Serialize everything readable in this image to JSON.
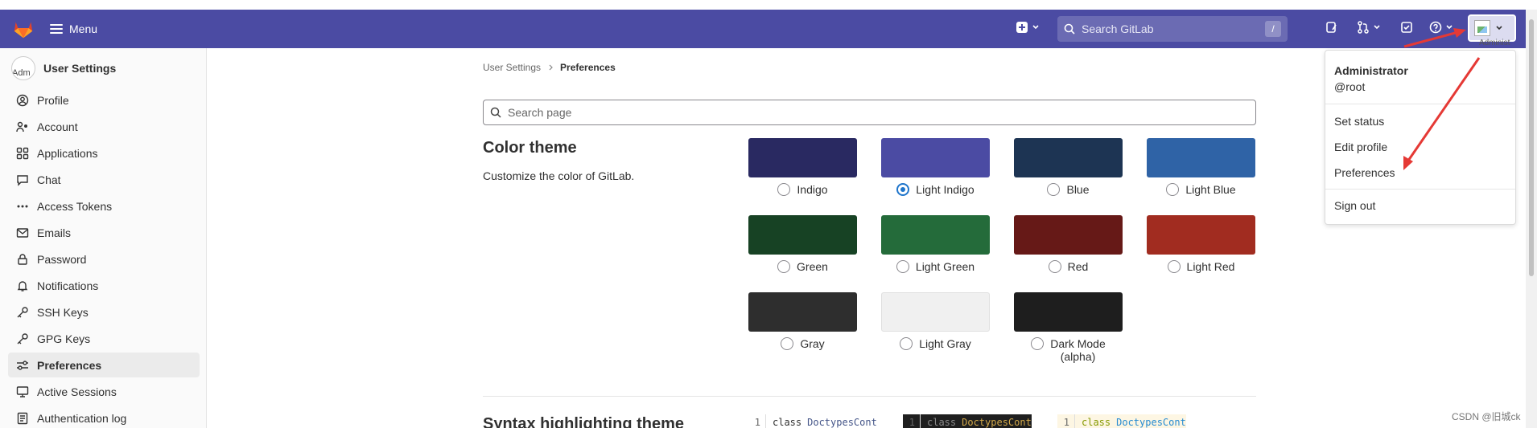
{
  "navbar": {
    "menu_label": "Menu",
    "search_placeholder": "Search GitLab",
    "search_shortcut": "/",
    "avatar_alt": "Administ"
  },
  "sidebar": {
    "title": "User Settings",
    "avatar_alt": "Adm",
    "items": [
      {
        "label": "Profile",
        "icon": "profile-icon"
      },
      {
        "label": "Account",
        "icon": "account-icon"
      },
      {
        "label": "Applications",
        "icon": "applications-icon"
      },
      {
        "label": "Chat",
        "icon": "chat-icon"
      },
      {
        "label": "Access Tokens",
        "icon": "token-icon"
      },
      {
        "label": "Emails",
        "icon": "mail-icon"
      },
      {
        "label": "Password",
        "icon": "lock-icon"
      },
      {
        "label": "Notifications",
        "icon": "bell-icon"
      },
      {
        "label": "SSH Keys",
        "icon": "key-icon"
      },
      {
        "label": "GPG Keys",
        "icon": "key-icon"
      },
      {
        "label": "Preferences",
        "icon": "preferences-icon",
        "active": true
      },
      {
        "label": "Active Sessions",
        "icon": "monitor-icon"
      },
      {
        "label": "Authentication log",
        "icon": "log-icon"
      }
    ]
  },
  "breadcrumb": {
    "parent": "User Settings",
    "current": "Preferences"
  },
  "page_search": {
    "placeholder": "Search page"
  },
  "color_theme": {
    "title": "Color theme",
    "description": "Customize the color of GitLab.",
    "options": [
      {
        "label": "Indigo",
        "color": "#292961",
        "checked": false
      },
      {
        "label": "Light Indigo",
        "color": "#4b4ba3",
        "checked": true
      },
      {
        "label": "Blue",
        "color": "#1d3453",
        "checked": false
      },
      {
        "label": "Light Blue",
        "color": "#2f63a6",
        "checked": false
      },
      {
        "label": "Green",
        "color": "#174224",
        "checked": false
      },
      {
        "label": "Light Green",
        "color": "#246b3a",
        "checked": false
      },
      {
        "label": "Red",
        "color": "#661917",
        "checked": false
      },
      {
        "label": "Light Red",
        "color": "#a12c20",
        "checked": false
      },
      {
        "label": "Gray",
        "color": "#2e2e2e",
        "checked": false
      },
      {
        "label": "Light Gray",
        "color": "#f0f0f0",
        "checked": false
      },
      {
        "label": "Dark Mode\n(alpha)",
        "color": "#1e1e1e",
        "checked": false
      }
    ]
  },
  "syntax": {
    "title": "Syntax highlighting theme",
    "previews": [
      {
        "line": "1",
        "keyword": "class",
        "name": "DoctypesCont",
        "bg": "#ffffff",
        "kw_color": "#303030",
        "name_color": "#445588"
      },
      {
        "line": "1",
        "keyword": "class",
        "name": "DoctypesCont",
        "bg": "#1f1f1f",
        "kw_color": "#8a8a8a",
        "name_color": "#d2a849"
      },
      {
        "line": "1",
        "keyword": "class",
        "name": "DoctypesCont",
        "bg": "#fdf6e3",
        "kw_color": "#859900",
        "name_color": "#268bd2"
      }
    ]
  },
  "user_menu": {
    "name": "Administrator",
    "handle": "@root",
    "items": [
      "Set status",
      "Edit profile",
      "Preferences",
      "Sign out"
    ]
  },
  "watermark": "CSDN @旧城ck",
  "accent": "#4b4ba3",
  "annotation_color": "#e53935"
}
